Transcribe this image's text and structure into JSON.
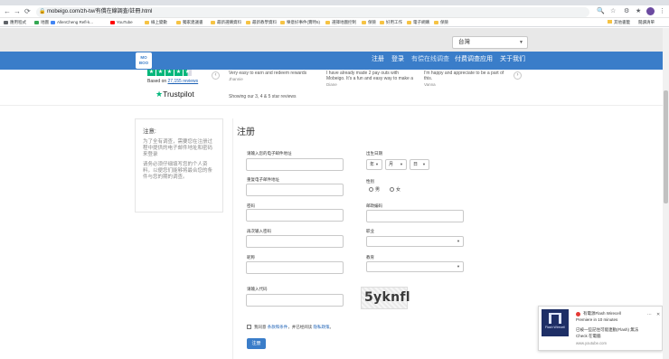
{
  "browser": {
    "back": "←",
    "forward": "→",
    "reload": "⟳",
    "url": "mobeigo.com/zh-tw/有償在線調査/註冊.html",
    "toolbar_icons": [
      "🔍",
      "☆",
      "⚙",
      "★",
      "✉",
      "⋮"
    ],
    "bookmarks": [
      "應用程式",
      "地圖",
      "AllenCheng Refl-k...",
      "YouTube",
      "線上變數",
      "獨家建議書",
      "最新選購資料",
      "最新教學資料",
      "樂意好事件(實時5)",
      "選擇地圖控制",
      "保險",
      "好用工作",
      "電子網購",
      "保險"
    ],
    "bookmarks_right": [
      "其他書籤",
      "閱讀清單"
    ]
  },
  "language_select": {
    "value": "台灣"
  },
  "nav": {
    "logo_text": "MO BOO",
    "links": [
      "注册",
      "登录",
      "有偿在线调查",
      "付费调查应用",
      "关于我们"
    ]
  },
  "reviews": {
    "based_on_prefix": "Based on ",
    "based_on_count": "27,155 reviews",
    "brand": "Trustpilot",
    "items": [
      {
        "text": "Very easy to earn and redeem rewards",
        "author": "Jhannie"
      },
      {
        "text": "I have already made 2 pay outs with Mobeigo. It's a fun and easy way to make a",
        "author": "Diane"
      },
      {
        "text": "I'm happy and appreciate to be a part of this.",
        "author": "Vanna"
      }
    ],
    "showing": "Showing our 3, 4 & 5 star reviews",
    "prev": "‹",
    "next": "›"
  },
  "notice": {
    "title": "注意:",
    "p1": "为了全有调查，需要您在注册过程中提供的电子邮件地址和密码来登录",
    "p2": "请务必须仔细填写您的个人资料，以便您们能够将最合您的条件与您的期的调查。"
  },
  "form": {
    "title": "注册",
    "email_label": "请输入您的电子邮件地址",
    "confirm_email_label": "重复电子邮件地址",
    "password_label": "密码",
    "confirm_password_label": "再次输入密码",
    "nickname_label": "昵称",
    "captcha_label": "请输入代码",
    "dob_label": "出生日期",
    "dob_year": "年",
    "dob_month": "月",
    "dob_day": "日",
    "gender_label": "性别",
    "gender_male": "男",
    "gender_female": "女",
    "postcode_label": "邮政编码",
    "occupation_label": "职业",
    "education_label": "教育",
    "captcha_text": "5yknfl",
    "agree_prefix": "我同意 ",
    "agree_link1": "条款和条件",
    "agree_mid": "，并已经阅读 ",
    "agree_link2": "隐私政策",
    "agree_suffix": "。",
    "submit": "注册"
  },
  "toast": {
    "title": "有電源Flash Wirecell",
    "line2": "Premiere in 10 minutes",
    "line3": "已被一些記住可能連動(Flash) 無法",
    "line4": "Check 在電腦",
    "source": "www.youtube.com",
    "thumb_label": "Flash Wirecell",
    "more": "⋯",
    "close": "✕"
  }
}
